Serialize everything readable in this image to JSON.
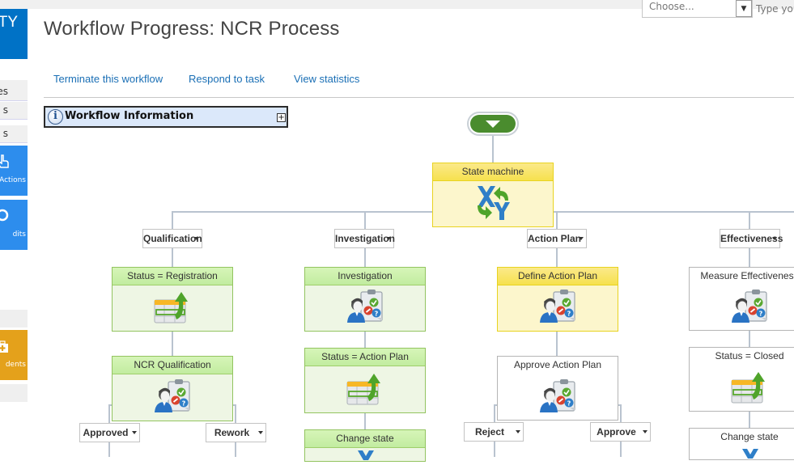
{
  "topbar": {
    "choose_select": {
      "value": "Choose...",
      "arrow_icon": "chevron-down-icon"
    },
    "search": {
      "placeholder": "Type you"
    }
  },
  "leftnav": {
    "brand_text": "TY",
    "rows": [
      {
        "label": ""
      },
      {
        "label": "es"
      },
      {
        "label": "s"
      },
      {
        "label": "s"
      }
    ],
    "tiles": [
      {
        "label": "Actions",
        "icon": "hand-pointer-icon",
        "color": "#2d8ded"
      },
      {
        "label": "dits",
        "icon": "circle-icon",
        "color": "#2d8ded"
      },
      {
        "label": "dents",
        "icon": "first-aid-icon",
        "color": "#e4a11b"
      }
    ]
  },
  "header": {
    "title": "Workflow Progress: NCR Process",
    "actions": [
      {
        "label": "Terminate this workflow"
      },
      {
        "label": "Respond to task"
      },
      {
        "label": "View statistics"
      }
    ]
  },
  "workflow_info": {
    "title": "Workflow Information",
    "expand_symbol": "+"
  },
  "diagram": {
    "colors": {
      "active_green": "#eef6e4",
      "current_yellow": "#fcf6cc",
      "pending_white": "#ffffff",
      "connector": "#b9c3cf",
      "start": "#4a8c2e"
    },
    "root": {
      "label": "State machine",
      "status": "current",
      "icon": "state-machine-icon"
    },
    "states": [
      {
        "label": "Qualification",
        "steps": [
          {
            "label": "Status = Registration",
            "status": "completed",
            "icon": "set-status-icon"
          },
          {
            "label": "NCR Qualification",
            "status": "completed",
            "icon": "task-icon"
          }
        ],
        "outcomes": [
          {
            "label": "Approved"
          },
          {
            "label": "Rework"
          }
        ]
      },
      {
        "label": "Investigation",
        "steps": [
          {
            "label": "Investigation",
            "status": "completed",
            "icon": "task-icon"
          },
          {
            "label": "Status = Action Plan",
            "status": "completed",
            "icon": "set-status-icon"
          },
          {
            "label": "Change state",
            "status": "completed",
            "icon": "change-state-icon"
          }
        ],
        "outcomes": []
      },
      {
        "label": "Action Plan",
        "steps": [
          {
            "label": "Define Action Plan",
            "status": "current",
            "icon": "task-icon"
          },
          {
            "label": "Approve Action Plan",
            "status": "pending",
            "icon": "task-icon"
          }
        ],
        "outcomes": [
          {
            "label": "Reject"
          },
          {
            "label": "Approve"
          }
        ]
      },
      {
        "label": "Effectiveness",
        "steps": [
          {
            "label": "Measure Effectiveness",
            "status": "pending",
            "icon": "task-icon"
          },
          {
            "label": "Status = Closed",
            "status": "pending",
            "icon": "set-status-icon"
          },
          {
            "label": "Change state",
            "status": "pending",
            "icon": "change-state-icon"
          }
        ],
        "outcomes": []
      }
    ]
  }
}
